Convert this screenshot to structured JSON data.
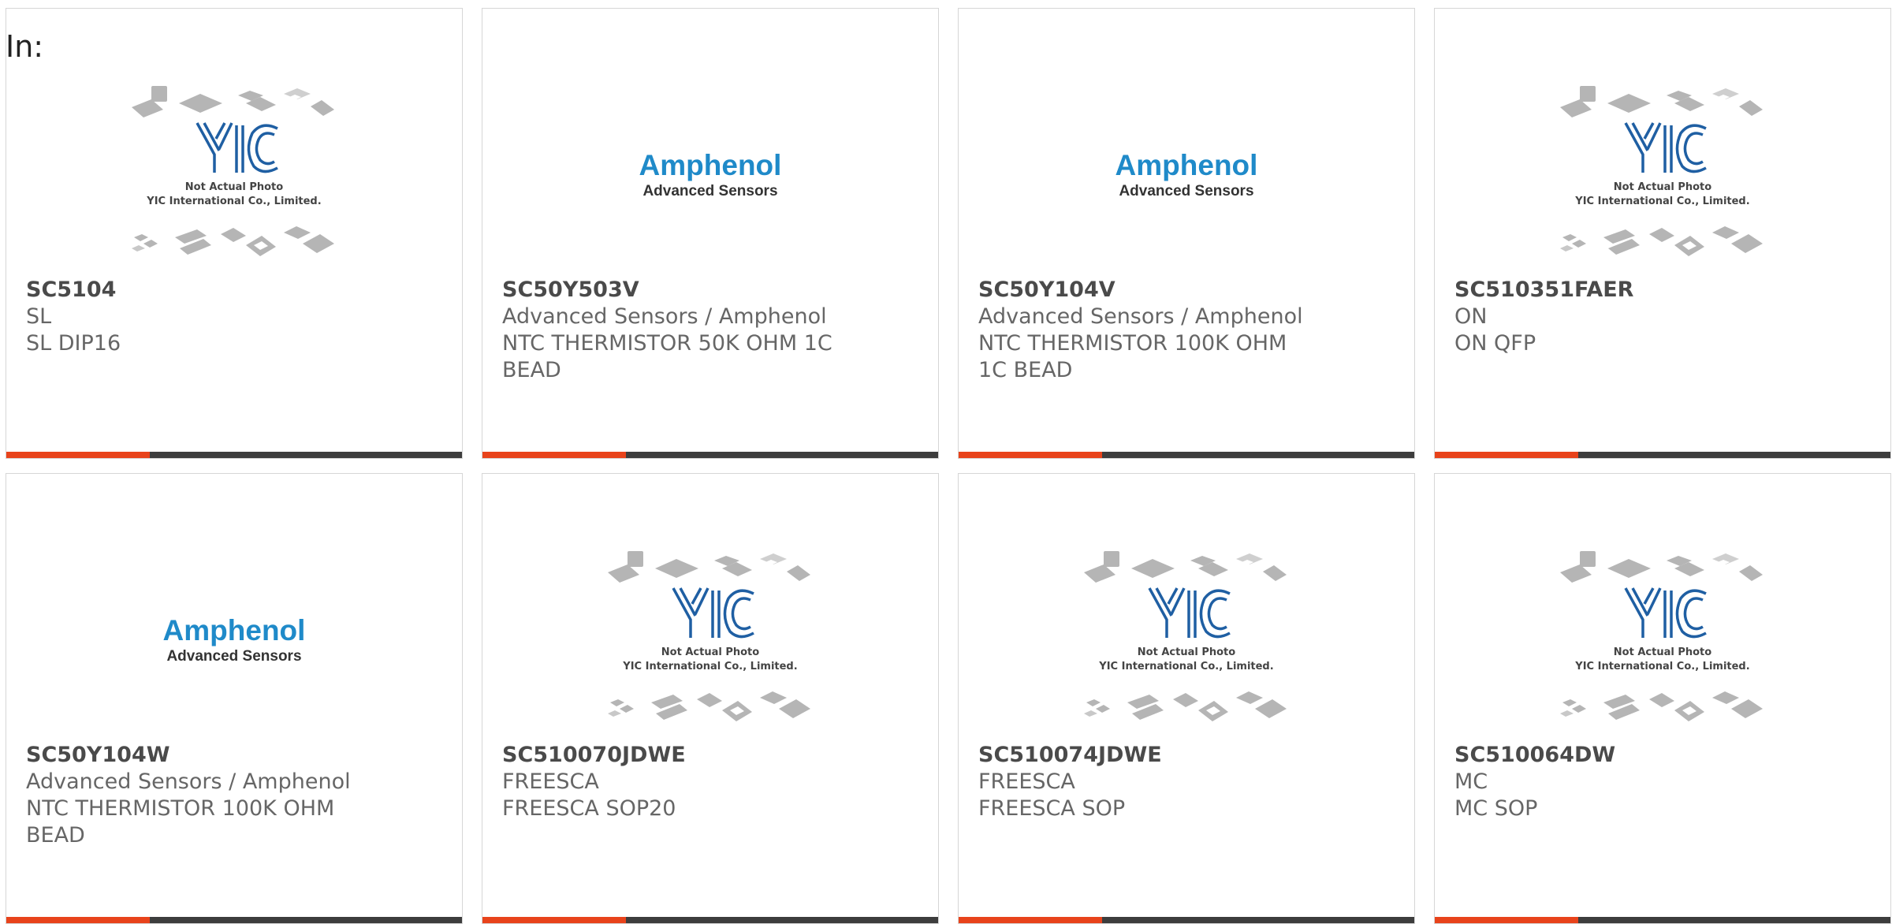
{
  "header": {
    "label": "In:"
  },
  "placeholder": {
    "line1": "Not Actual Photo",
    "line2": "YIC International Co., Limited."
  },
  "amphenol": {
    "name": "Amphenol",
    "tagline": "Advanced Sensors"
  },
  "colors": {
    "accent": "#e8431b",
    "bar": "#3d3d3d",
    "amphenol_blue": "#1f8ac9"
  },
  "products": [
    {
      "part": "SC5104",
      "brand": "SL",
      "desc": "SL DIP16",
      "image": "yic-placeholder-image"
    },
    {
      "part": "SC50Y503V",
      "brand": "Advanced Sensors / Amphenol",
      "desc": "NTC THERMISTOR 50K OHM 1C BEAD",
      "image": "amphenol-logo"
    },
    {
      "part": "SC50Y104V",
      "brand": "Advanced Sensors / Amphenol",
      "desc": "NTC THERMISTOR 100K OHM 1C BEAD",
      "image": "amphenol-logo"
    },
    {
      "part": "SC510351FAER",
      "brand": "ON",
      "desc": "ON QFP",
      "image": "yic-placeholder-image"
    },
    {
      "part": "SC50Y104W",
      "brand": "Advanced Sensors / Amphenol",
      "desc": "NTC THERMISTOR 100K OHM BEAD",
      "image": "amphenol-logo"
    },
    {
      "part": "SC510070JDWE",
      "brand": "FREESCA",
      "desc": "FREESCA SOP20",
      "image": "yic-placeholder-image"
    },
    {
      "part": "SC510074JDWE",
      "brand": "FREESCA",
      "desc": "FREESCA SOP",
      "image": "yic-placeholder-image"
    },
    {
      "part": "SC510064DW",
      "brand": "MC",
      "desc": "MC SOP",
      "image": "yic-placeholder-image"
    }
  ]
}
